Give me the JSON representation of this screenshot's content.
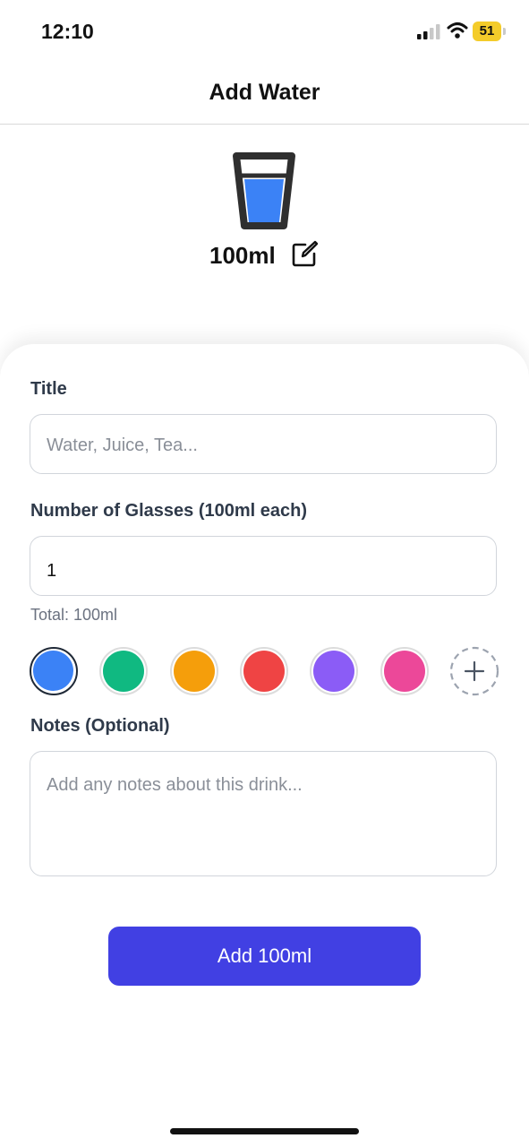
{
  "status_bar": {
    "time": "12:10",
    "battery_level": "51",
    "signal_icon": "cellular-signal-icon",
    "wifi_icon": "wifi-icon",
    "battery_color": "#f4cc2a"
  },
  "header": {
    "title": "Add Water"
  },
  "hero": {
    "icon": "water-glass-icon",
    "amount": "100ml",
    "edit_icon": "edit-icon",
    "water_color": "#3b82f6"
  },
  "form": {
    "title_label": "Title",
    "title_placeholder": "Water, Juice, Tea...",
    "glasses_label": "Number of Glasses (100ml each)",
    "glasses_value": "1",
    "total_text": "Total: 100ml",
    "colors": [
      {
        "name": "blue",
        "hex": "#3b82f6",
        "selected": true
      },
      {
        "name": "green",
        "hex": "#10b981",
        "selected": false
      },
      {
        "name": "orange",
        "hex": "#f59e0b",
        "selected": false
      },
      {
        "name": "red",
        "hex": "#ef4444",
        "selected": false
      },
      {
        "name": "purple",
        "hex": "#8b5cf6",
        "selected": false
      },
      {
        "name": "pink",
        "hex": "#ec4899",
        "selected": false
      }
    ],
    "add_color_icon": "plus-icon",
    "notes_label": "Notes (Optional)",
    "notes_placeholder": "Add any notes about this drink..."
  },
  "submit": {
    "label": "Add 100ml",
    "color": "#4140e3"
  }
}
